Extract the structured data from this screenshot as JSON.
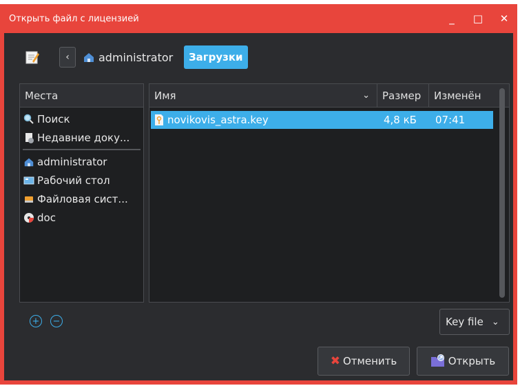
{
  "window": {
    "title": "Открыть файл с лицензией"
  },
  "breadcrumb": {
    "home": "administrator",
    "current": "Загрузки"
  },
  "places": {
    "header": "Места",
    "items": [
      {
        "label": "Поиск",
        "icon": "search-icon"
      },
      {
        "label": "Недавние доку...",
        "icon": "recent-documents-icon"
      },
      {
        "label": "administrator",
        "icon": "home-folder-icon"
      },
      {
        "label": "Рабочий стол",
        "icon": "desktop-icon"
      },
      {
        "label": "Файловая сист...",
        "icon": "filesystem-icon"
      },
      {
        "label": "doc",
        "icon": "disc-icon"
      }
    ]
  },
  "files": {
    "columns": [
      "Имя",
      "Размер",
      "Изменён"
    ],
    "rows": [
      {
        "name": "novikovis_astra.key",
        "size": "4,8 кБ",
        "modified": "07:41",
        "icon": "key-file-icon"
      }
    ]
  },
  "filter": {
    "value": "Key file"
  },
  "buttons": {
    "cancel": "Отменить",
    "open": "Открыть"
  },
  "colors": {
    "accent": "#3daee9",
    "titlebar": "#e8453c",
    "background": "#2b2c2f"
  }
}
